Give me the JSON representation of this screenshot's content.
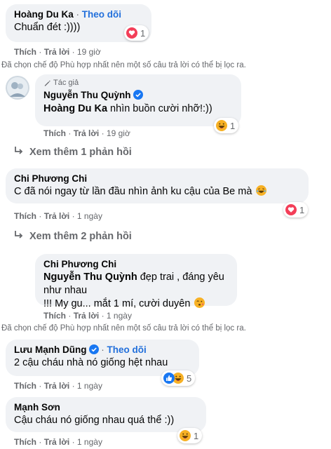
{
  "comments": [
    {
      "author": "Hoàng Du Ka",
      "follow_label": "Theo dõi",
      "separator": "·",
      "text": "Chuẩn đét :))))",
      "reaction_count": "1",
      "reaction_icons": [
        "heart-icon"
      ],
      "like_label": "Thích",
      "reply_label": "Trả lời",
      "time": "19 giờ"
    },
    {
      "author_badge": "Tác giả",
      "author": "Nguyễn Thu Quỳnh",
      "mention": "Hoàng Du Ka",
      "text": " nhìn buồn cười nhỡ!:))",
      "reaction_count": "1",
      "reaction_icons": [
        "haha-icon"
      ],
      "like_label": "Thích",
      "reply_label": "Trả lời",
      "time": "19 giờ"
    },
    {
      "author": "Chi Phương Chi",
      "text": "C đã nói ngay từ lần đầu nhìn ảnh ku cậu của Be mà",
      "reaction_count": "1",
      "reaction_icons": [
        "heart-icon"
      ],
      "like_label": "Thích",
      "reply_label": "Trả lời",
      "time": "1 ngày"
    },
    {
      "author": "Chi Phương Chi",
      "mention": "Nguyễn Thu Quỳnh",
      "text_line1": " đẹp trai , đáng yêu như nhau",
      "text_line2": "!!! My gu... mắt 1 mí, cười duyên",
      "like_label": "Thích",
      "reply_label": "Trả lời",
      "time": "1 ngày"
    },
    {
      "author": "Lưu Mạnh Dũng",
      "follow_label": "Theo dõi",
      "separator": "·",
      "text": "2 cậu cháu nhà nó giống hệt nhau",
      "reaction_count": "5",
      "reaction_icons": [
        "like-icon",
        "haha-icon"
      ],
      "like_label": "Thích",
      "reply_label": "Trả lời",
      "time": "1 ngày"
    },
    {
      "author": "Mạnh Sơn",
      "text": "Cậu cháu nó giống nhau quá thể :))",
      "reaction_count": "1",
      "reaction_icons": [
        "haha-icon"
      ],
      "like_label": "Thích",
      "reply_label": "Trả lời",
      "time": "1 ngày"
    }
  ],
  "filter_note": "Đã chọn chế độ Phù hợp nhất nên một số câu trả lời có thể bị lọc ra.",
  "view_more": {
    "one": "Xem thêm 1 phản hồi",
    "two": "Xem thêm 2 phản hồi"
  },
  "action_separator": "·",
  "colors": {
    "bubble": "#f0f2f5",
    "link_blue": "#216fdb",
    "muted": "#65676b",
    "heart": "#f33e58",
    "haha": "#f7b125",
    "like": "#1877f2"
  }
}
